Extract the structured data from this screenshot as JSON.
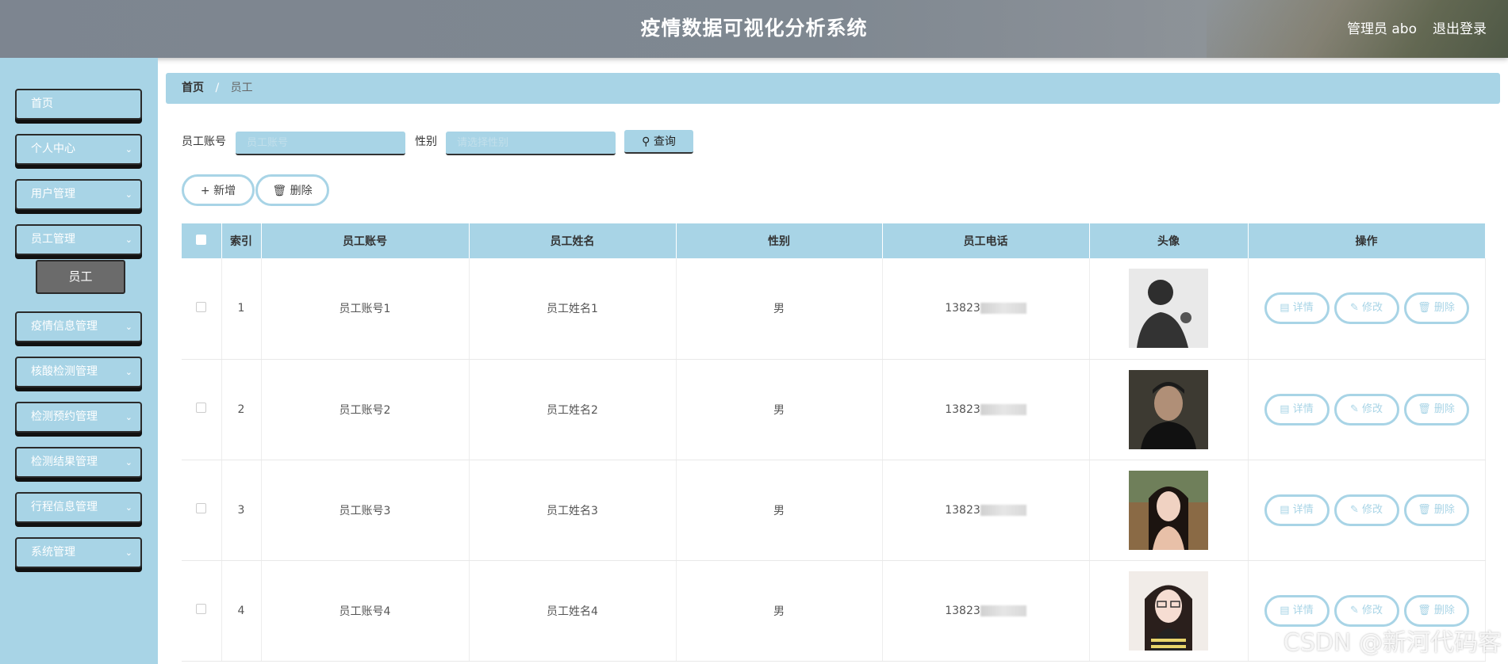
{
  "header": {
    "title": "疫情数据可视化分析系统",
    "user": "管理员 abo",
    "logout": "退出登录"
  },
  "sidebar": {
    "items": [
      {
        "label": "首页",
        "has_chevron": false
      },
      {
        "label": "个人中心",
        "has_chevron": true
      },
      {
        "label": "用户管理",
        "has_chevron": true
      },
      {
        "label": "员工管理",
        "has_chevron": true
      },
      {
        "label": "疫情信息管理",
        "has_chevron": true
      },
      {
        "label": "核酸检测管理",
        "has_chevron": true
      },
      {
        "label": "检测预约管理",
        "has_chevron": true
      },
      {
        "label": "检测结果管理",
        "has_chevron": true
      },
      {
        "label": "行程信息管理",
        "has_chevron": true
      },
      {
        "label": "系统管理",
        "has_chevron": true
      }
    ],
    "submenu": {
      "label": "员工"
    }
  },
  "breadcrumb": {
    "home": "首页",
    "separator": "/",
    "current": "员工"
  },
  "search": {
    "account_label": "员工账号",
    "account_placeholder": "员工账号",
    "gender_label": "性别",
    "gender_placeholder": "请选择性别",
    "query_button": "查询",
    "query_icon": "search-icon"
  },
  "actions": {
    "add": "新增",
    "add_icon": "plus-icon",
    "delete": "删除",
    "delete_icon": "trash-icon"
  },
  "table": {
    "headers": [
      "",
      "索引",
      "员工账号",
      "员工姓名",
      "性别",
      "员工电话",
      "头像",
      "操作"
    ],
    "rows": [
      {
        "index": "1",
        "account": "员工账号1",
        "name": "员工姓名1",
        "gender": "男",
        "phone": "13823"
      },
      {
        "index": "2",
        "account": "员工账号2",
        "name": "员工姓名2",
        "gender": "男",
        "phone": "13823"
      },
      {
        "index": "3",
        "account": "员工账号3",
        "name": "员工姓名3",
        "gender": "男",
        "phone": "13823"
      },
      {
        "index": "4",
        "account": "员工账号4",
        "name": "员工姓名4",
        "gender": "男",
        "phone": "13823"
      }
    ],
    "row_actions": {
      "detail": "详情",
      "edit": "修改",
      "delete": "删除"
    }
  },
  "watermark": "CSDN @新河代码客",
  "colors": {
    "accent": "#a8d4e6",
    "header": "#7f8891",
    "submenu_active": "#6b6b6b"
  }
}
